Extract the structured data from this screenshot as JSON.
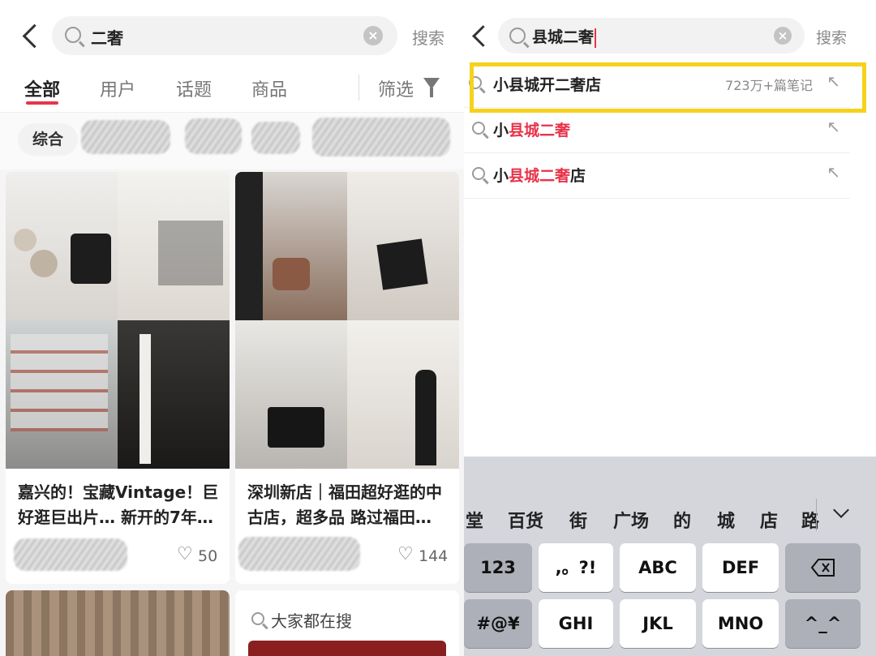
{
  "left": {
    "search": {
      "query": "二奢",
      "action": "搜索"
    },
    "tabs": [
      "全部",
      "用户",
      "话题",
      "商品"
    ],
    "filter_label": "筛选",
    "chip": "综合",
    "cards": [
      {
        "title_line1": "嘉兴的！宝藏Vintage！巨",
        "title_line2": "好逛巨出片… 新开的7年…",
        "likes": "50"
      },
      {
        "title_line1": "深圳新店｜福田超好逛的中",
        "title_line2": "古店，超多品 路过福田…",
        "likes": "144"
      }
    ],
    "trending_label": "大家都在搜"
  },
  "right": {
    "search": {
      "query": "县城二奢",
      "action": "搜索"
    },
    "suggestions": [
      {
        "prefix": "小县城开二奢店",
        "hl": "",
        "suffix": "",
        "meta": "723万+篇笔记"
      },
      {
        "prefix": "小",
        "hl": "县城二奢",
        "suffix": "",
        "meta": ""
      },
      {
        "prefix": "小",
        "hl": "县城二奢",
        "suffix": "店",
        "meta": ""
      }
    ],
    "candidates": [
      "堂",
      "百货",
      "街",
      "广场",
      "的",
      "城",
      "店",
      "路"
    ],
    "keys_row1": [
      "123",
      ",。?!",
      "ABC",
      "DEF"
    ],
    "keys_row2": [
      "#@¥",
      "GHI",
      "JKL",
      "MNO",
      "^_^"
    ]
  },
  "colors": {
    "accent": "#e8334a",
    "highlight": "#f5d21c"
  }
}
